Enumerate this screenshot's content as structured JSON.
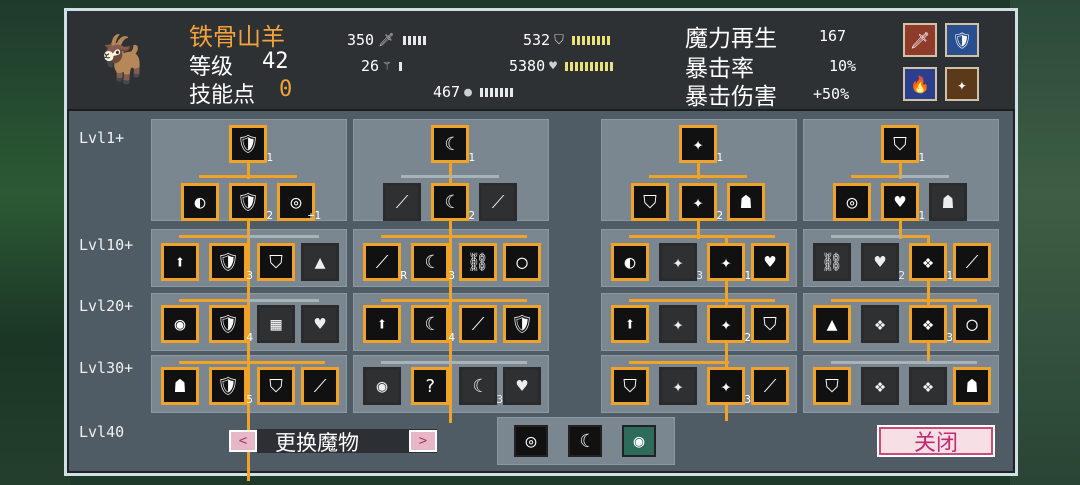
{
  "monster": {
    "name": "铁骨山羊",
    "level_label": "等级",
    "level": "42",
    "skill_points_label": "技能点",
    "skill_points": "0"
  },
  "stats": {
    "attack": "350",
    "magic": "26",
    "stamina": "467",
    "defense": "532",
    "health": "5380"
  },
  "right_stats": {
    "mana_regen_label": "魔力再生",
    "mana_regen": "167",
    "crit_rate_label": "暴击率",
    "crit_rate": "10%",
    "crit_damage_label": "暴击伤害",
    "crit_damage": "+50%"
  },
  "level_labels": [
    "Lvl1+",
    "Lvl10+",
    "Lvl20+",
    "Lvl30+",
    "Lvl40"
  ],
  "node_counts": {
    "c1_top": "1",
    "c1_r2_mid": "2",
    "c1_r2_right": "+1",
    "c1_l10": "3",
    "c1_l20": "4",
    "c1_l30": "5",
    "c2_top": "1",
    "c2_r2_mid": "2",
    "c2_l10_left": "R",
    "c2_l10": "3",
    "c2_l20": "4",
    "c2_l30": "3",
    "c3_top": "1",
    "c3_r2_mid": "2",
    "c3_l10_a": "3",
    "c3_l10_b": "1",
    "c3_l20": "2",
    "c3_l30": "3",
    "c4_top": "1",
    "c4_r2_mid": "1",
    "c4_l10_a": "2",
    "c4_l10_b": "1",
    "c4_l20": "3"
  },
  "footer": {
    "change_monster": "更换魔物",
    "prev": "<",
    "next": ">",
    "close": "关闭"
  },
  "icons": {
    "sword": "sword-icon",
    "wand": "wand-icon",
    "shield": "shield-icon",
    "heart": "heart-icon",
    "stamina": "stamina-icon"
  },
  "colors": {
    "accent": "#f0a327",
    "name": "#f2a23a",
    "panel": "#4f5c66",
    "header": "#2e3134",
    "close_text": "#c42a70"
  }
}
